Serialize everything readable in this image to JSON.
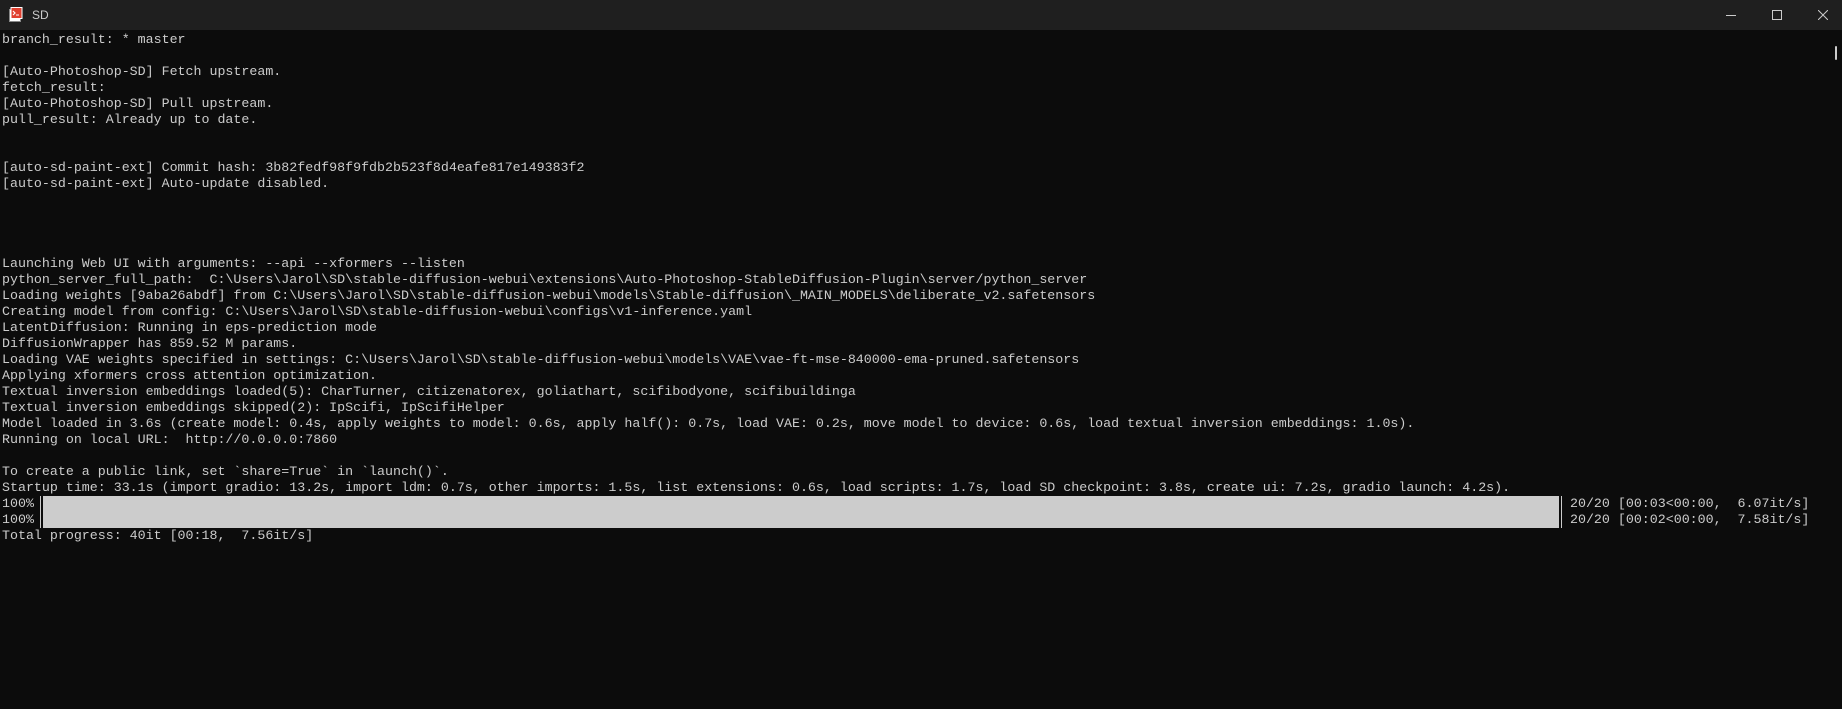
{
  "window": {
    "title": "SD",
    "accent": "#0c0c0c",
    "text_color": "#cccccc"
  },
  "console": {
    "lines_before": [
      "branch_result: * master",
      "",
      "[Auto-Photoshop-SD] Fetch upstream.",
      "fetch_result:",
      "[Auto-Photoshop-SD] Pull upstream.",
      "pull_result: Already up to date.",
      "",
      "",
      "[auto-sd-paint-ext] Commit hash: 3b82fedf98f9fdb2b523f8d4eafe817e149383f2",
      "[auto-sd-paint-ext] Auto-update disabled.",
      "",
      "",
      "",
      "",
      "Launching Web UI with arguments: --api --xformers --listen",
      "python_server_full_path:  C:\\Users\\Jarol\\SD\\stable-diffusion-webui\\extensions\\Auto-Photoshop-StableDiffusion-Plugin\\server/python_server",
      "Loading weights [9aba26abdf] from C:\\Users\\Jarol\\SD\\stable-diffusion-webui\\models\\Stable-diffusion\\_MAIN_MODELS\\deliberate_v2.safetensors",
      "Creating model from config: C:\\Users\\Jarol\\SD\\stable-diffusion-webui\\configs\\v1-inference.yaml",
      "LatentDiffusion: Running in eps-prediction mode",
      "DiffusionWrapper has 859.52 M params.",
      "Loading VAE weights specified in settings: C:\\Users\\Jarol\\SD\\stable-diffusion-webui\\models\\VAE\\vae-ft-mse-840000-ema-pruned.safetensors",
      "Applying xformers cross attention optimization.",
      "Textual inversion embeddings loaded(5): CharTurner, citizenatorex, goliathart, scifibodyone, scifibuildinga",
      "Textual inversion embeddings skipped(2): IpScifi, IpScifiHelper",
      "Model loaded in 3.6s (create model: 0.4s, apply weights to model: 0.6s, apply half(): 0.7s, load VAE: 0.2s, move model to device: 0.6s, load textual inversion embeddings: 1.0s).",
      "Running on local URL:  http://0.0.0.0:7860",
      "",
      "To create a public link, set `share=True` in `launch()`.",
      "Startup time: 33.1s (import gradio: 13.2s, import ldm: 0.7s, other imports: 1.5s, list extensions: 0.6s, load scripts: 1.7s, load SD checkpoint: 3.8s, create ui: 7.2s, gradio launch: 4.2s)."
    ],
    "progress_bars": [
      {
        "percent_label": "100%",
        "fraction": 1.0,
        "stats": " 20/20 [00:03<00:00,  6.07it/s]"
      },
      {
        "percent_label": "100%",
        "fraction": 1.0,
        "stats": " 20/20 [00:02<00:00,  7.58it/s]"
      }
    ],
    "total_progress": "Total progress: 40it [00:18,  7.56it/s]"
  }
}
